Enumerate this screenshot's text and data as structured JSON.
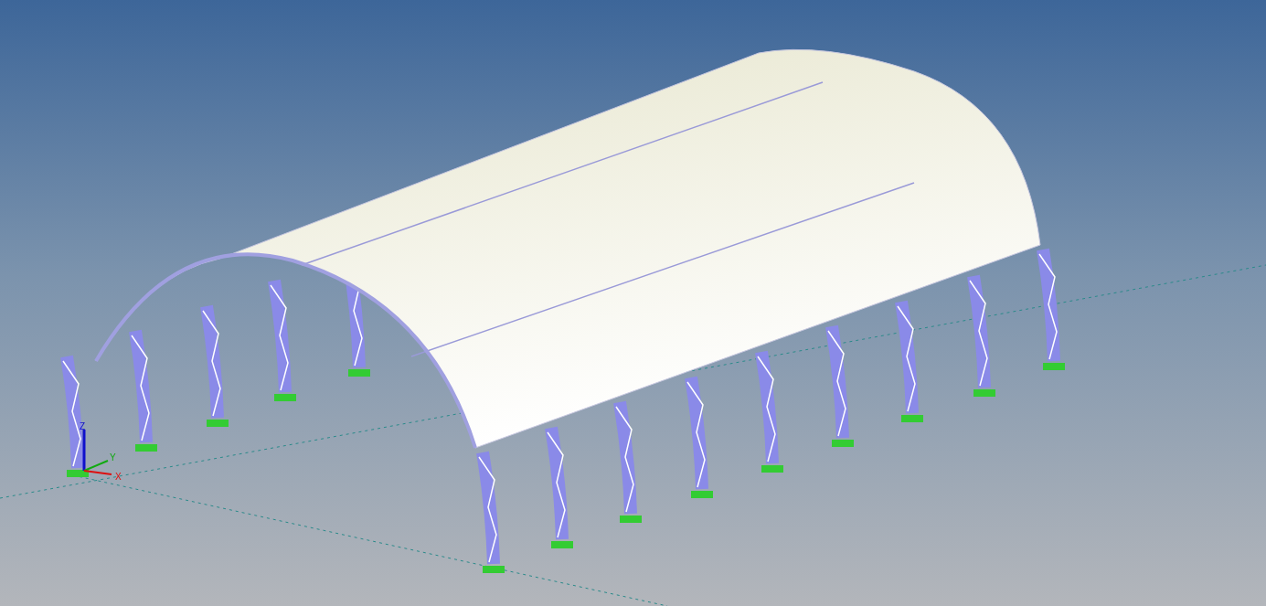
{
  "viewport": {
    "axis_triad": {
      "x_label": "X",
      "y_label": "Y",
      "z_label": "Z"
    }
  }
}
